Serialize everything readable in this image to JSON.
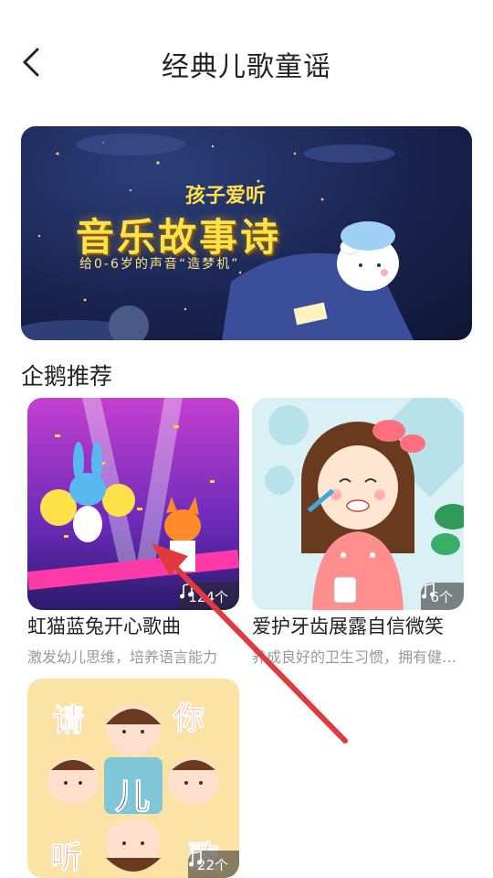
{
  "header": {
    "title": "经典儿歌童谣"
  },
  "banner": {
    "brand": "孩子爱听",
    "headline": "音乐故事诗",
    "tagline": "给0-6岁的声音“造梦机”"
  },
  "section": {
    "title": "企鹅推荐"
  },
  "cards": [
    {
      "title": "虹猫蓝兔开心歌曲",
      "desc": "激发幼儿思维，培养语言能力",
      "count": "124个"
    },
    {
      "title": "爱护牙齿展露自信微笑",
      "desc": "养成良好的卫生习惯，拥有健康牙齿",
      "count": "6个"
    },
    {
      "title": "",
      "desc": "",
      "count": "22个",
      "art_text": [
        "请",
        "你",
        "儿",
        "听",
        "歌"
      ]
    }
  ],
  "icons": {
    "back": "chevron-left-icon",
    "music": "music-note-icon"
  },
  "colors": {
    "accent_yellow": "#ffe14a",
    "arrow_red": "#e0393e"
  }
}
